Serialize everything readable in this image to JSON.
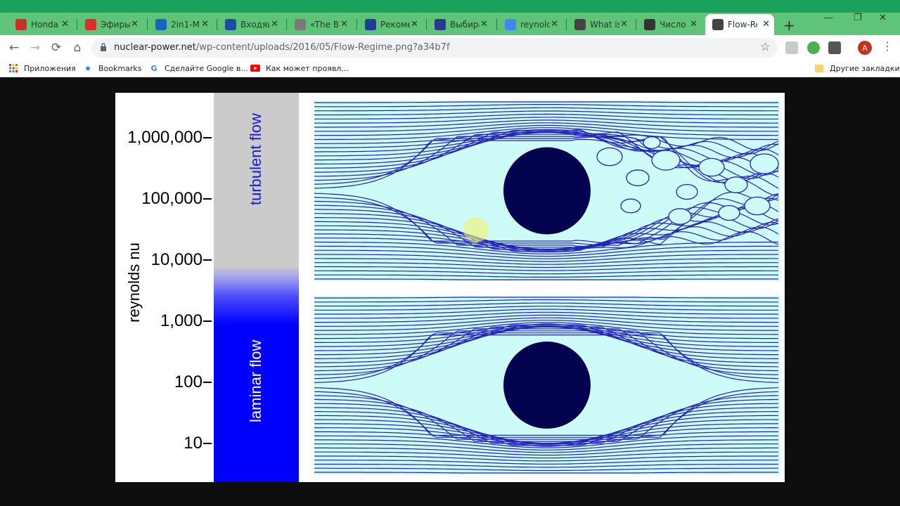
{
  "browser": {
    "tabs": [
      {
        "label": "Honda",
        "icon": "honda-icon",
        "color": "#c9302c"
      },
      {
        "label": "Эфиры",
        "icon": "calendar-icon",
        "color": "#d9302c"
      },
      {
        "label": "2in1-M",
        "icon": "wave-icon",
        "color": "#1565c0"
      },
      {
        "label": "Входящ",
        "icon": "mail-icon",
        "color": "#1a4fa0"
      },
      {
        "label": "«The B",
        "icon": "globe-icon",
        "color": "#7a7a7a"
      },
      {
        "label": "Рекоме",
        "icon": "leaf-icon",
        "color": "#1c3f94"
      },
      {
        "label": "Выбира",
        "icon": "runner-icon",
        "color": "#2a3a8a"
      },
      {
        "label": "reynold",
        "icon": "google-icon",
        "color": "#4285f4"
      },
      {
        "label": "What is",
        "icon": "atom-icon",
        "color": "#444444"
      },
      {
        "label": "Число",
        "icon": "wikipedia-icon",
        "color": "#333333"
      },
      {
        "label": "Flow-Re",
        "icon": "atom-icon",
        "color": "#444444"
      }
    ],
    "active_tab_index": 10,
    "new_tab_symbol": "+",
    "window_controls": {
      "minimize": "—",
      "restore": "❐",
      "close": "✕"
    },
    "address": {
      "host": "nuclear-power.net",
      "path": "/wp-content/uploads/2016/05/Flow-Regime.png?a34b7f"
    },
    "avatar_letter": "A",
    "bookmarks": [
      {
        "label": "Приложения",
        "icon": "apps-grid-icon"
      },
      {
        "label": "Bookmarks",
        "icon": "star-icon"
      },
      {
        "label": "Сделайте Google в...",
        "icon": "google-icon"
      },
      {
        "label": "Как может проявл...",
        "icon": "youtube-icon"
      }
    ],
    "other_bookmarks": "Другие закладки"
  },
  "figure": {
    "y_ticks": [
      "1,000,000",
      "100,000",
      "10,000",
      "1,000",
      "100",
      "10"
    ],
    "y_axis_label": "reynolds nu",
    "regimes": [
      {
        "label": "turbulent flow",
        "color": "#1818d8"
      },
      {
        "label": "laminar flow",
        "color": "#ffffff"
      }
    ],
    "colors": {
      "turbulent_band": "#cbcbcb",
      "laminar_band": "#0000ff",
      "streamline": "#2222bb",
      "cylinder": "#02024f",
      "flow_background": "#cdfcf8"
    }
  }
}
